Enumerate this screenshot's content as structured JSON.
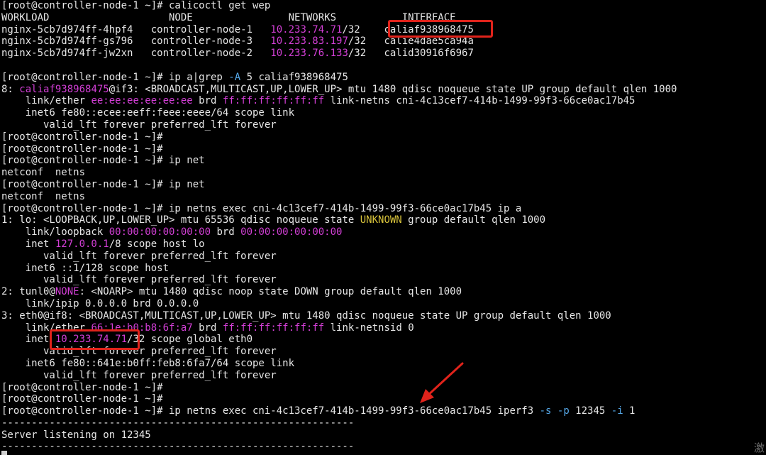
{
  "terminal": {
    "lines": [
      [
        [
          "n",
          "[root@controller-node-1 ~]# calicoctl get wep"
        ]
      ],
      [
        [
          "n",
          "WORKLOAD                    NODE                NETWORKS           INTERFACE"
        ]
      ],
      [
        [
          "n",
          "nginx-5cb7d974ff-4hpf4   controller-node-1   "
        ],
        [
          "m",
          "10.233.74.71"
        ],
        [
          "n",
          "/32    caliaf938968475"
        ]
      ],
      [
        [
          "n",
          "nginx-5cb7d974ff-gs796   controller-node-3   "
        ],
        [
          "m",
          "10.233.83.197"
        ],
        [
          "n",
          "/32   calie4dae5ca94a"
        ]
      ],
      [
        [
          "n",
          "nginx-5cb7d974ff-jw2xn   controller-node-2   "
        ],
        [
          "m",
          "10.233.76.133"
        ],
        [
          "n",
          "/32   calid30916f6967"
        ]
      ],
      [
        [
          "n",
          ""
        ]
      ],
      [
        [
          "n",
          "[root@controller-node-1 ~]# ip a|grep "
        ],
        [
          "c",
          "-A"
        ],
        [
          "n",
          " 5 caliaf938968475"
        ]
      ],
      [
        [
          "n",
          "8: "
        ],
        [
          "m",
          "caliaf938968475"
        ],
        [
          "n",
          "@if3: <BROADCAST,MULTICAST,UP,LOWER_UP> mtu 1480 qdisc noqueue state UP group default qlen 1000"
        ]
      ],
      [
        [
          "n",
          "    link/ether "
        ],
        [
          "m",
          "ee:ee:ee:ee:ee:ee"
        ],
        [
          "n",
          " brd "
        ],
        [
          "m",
          "ff:ff:ff:ff:ff:ff"
        ],
        [
          "n",
          " link-netns cni-4c13cef7-414b-1499-99f3-66ce0ac17b45"
        ]
      ],
      [
        [
          "n",
          "    inet6 fe80::ecee:eeff:feee:eeee/64 scope link"
        ]
      ],
      [
        [
          "n",
          "       valid_lft forever preferred_lft forever"
        ]
      ],
      [
        [
          "n",
          "[root@controller-node-1 ~]#"
        ]
      ],
      [
        [
          "n",
          "[root@controller-node-1 ~]#"
        ]
      ],
      [
        [
          "n",
          "[root@controller-node-1 ~]# ip net"
        ]
      ],
      [
        [
          "n",
          "netconf  netns"
        ]
      ],
      [
        [
          "n",
          "[root@controller-node-1 ~]# ip net"
        ]
      ],
      [
        [
          "n",
          "netconf  netns"
        ]
      ],
      [
        [
          "n",
          "[root@controller-node-1 ~]# ip netns exec cni-4c13cef7-414b-1499-99f3-66ce0ac17b45 ip a"
        ]
      ],
      [
        [
          "n",
          "1: lo: <LOOPBACK,UP,LOWER_UP> mtu 65536 qdisc noqueue state "
        ],
        [
          "y",
          "UNKNOWN"
        ],
        [
          "n",
          " group default qlen 1000"
        ]
      ],
      [
        [
          "n",
          "    link/loopback "
        ],
        [
          "m",
          "00:00:00:00:00:00"
        ],
        [
          "n",
          " brd "
        ],
        [
          "m",
          "00:00:00:00:00:00"
        ]
      ],
      [
        [
          "n",
          "    inet "
        ],
        [
          "m",
          "127.0.0.1"
        ],
        [
          "n",
          "/8 scope host lo"
        ]
      ],
      [
        [
          "n",
          "       valid_lft forever preferred_lft forever"
        ]
      ],
      [
        [
          "n",
          "    inet6 ::1/128 scope host"
        ]
      ],
      [
        [
          "n",
          "       valid_lft forever preferred_lft forever"
        ]
      ],
      [
        [
          "n",
          "2: tunl0@"
        ],
        [
          "m",
          "NONE"
        ],
        [
          "n",
          ": <NOARP> mtu 1480 qdisc noop state DOWN group default qlen 1000"
        ]
      ],
      [
        [
          "n",
          "    link/ipip 0.0.0.0 brd 0.0.0.0"
        ]
      ],
      [
        [
          "n",
          "3: eth0@if8: <BROADCAST,MULTICAST,UP,LOWER_UP> mtu 1480 qdisc noqueue state UP group default qlen 1000"
        ]
      ],
      [
        [
          "n",
          "    link/ether "
        ],
        [
          "m",
          "66:1e:b0:b8:6f:a7"
        ],
        [
          "n",
          " brd "
        ],
        [
          "m",
          "ff:ff:ff:ff:ff:ff"
        ],
        [
          "n",
          " link-netnsid 0"
        ]
      ],
      [
        [
          "n",
          "    inet "
        ],
        [
          "m",
          "10.233.74.71"
        ],
        [
          "n",
          "/32 scope global eth0"
        ]
      ],
      [
        [
          "n",
          "       valid_lft forever preferred_lft forever"
        ]
      ],
      [
        [
          "n",
          "    inet6 fe80::641e:b0ff:feb8:6fa7/64 scope link"
        ]
      ],
      [
        [
          "n",
          "       valid_lft forever preferred_lft forever"
        ]
      ],
      [
        [
          "n",
          "[root@controller-node-1 ~]#"
        ]
      ],
      [
        [
          "n",
          "[root@controller-node-1 ~]#"
        ]
      ],
      [
        [
          "n",
          "[root@controller-node-1 ~]# ip netns exec cni-4c13cef7-414b-1499-99f3-66ce0ac17b45 iperf3 "
        ],
        [
          "c",
          "-s"
        ],
        [
          "n",
          " "
        ],
        [
          "c",
          "-p"
        ],
        [
          "n",
          " 12345 "
        ],
        [
          "c",
          "-i"
        ],
        [
          "n",
          " 1"
        ]
      ],
      [
        [
          "n",
          "-----------------------------------------------------------"
        ]
      ],
      [
        [
          "n",
          "Server listening on 12345"
        ]
      ],
      [
        [
          "n",
          "-----------------------------------------------------------"
        ]
      ]
    ]
  },
  "colors": {
    "background": "#000000",
    "text": "#e6e6e6",
    "magenta": "#d33fd6",
    "yellow": "#d8c33b",
    "cyan": "#56a8e8",
    "annotation_red": "#e0231b"
  },
  "icons": {
    "annotation_arrow": "red-arrow-icon",
    "cursor": "terminal-cursor-icon"
  },
  "watermark": "激"
}
